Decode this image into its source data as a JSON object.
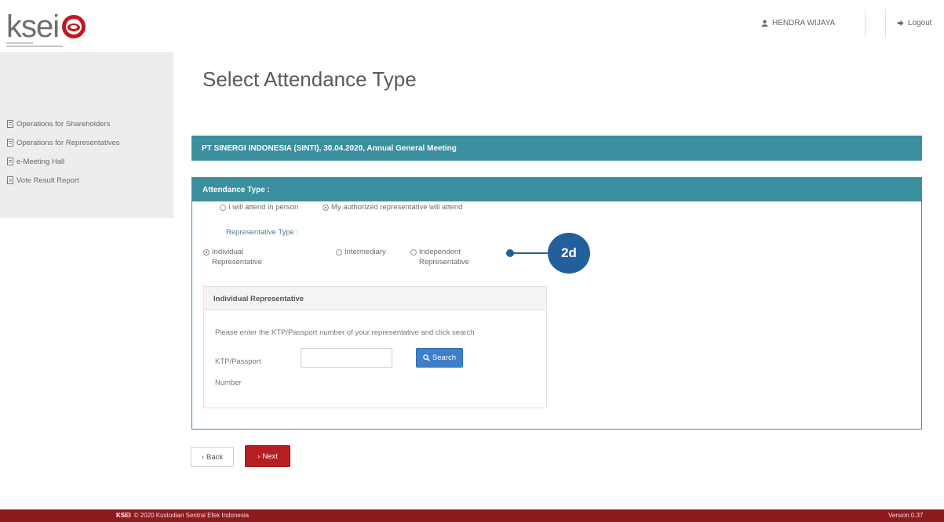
{
  "header": {
    "logo_text": "ksei",
    "user_label": "HENDRA WIJAYA",
    "logout_label": "Logout"
  },
  "sidebar": {
    "items": [
      {
        "label": "Operations for Shareholders",
        "icon": "document-icon"
      },
      {
        "label": "Operations for Representatives",
        "icon": "document-icon"
      },
      {
        "label": "e-Meeting Hall",
        "icon": "document-icon"
      },
      {
        "label": "Vote Result Report",
        "icon": "document-icon"
      }
    ]
  },
  "main": {
    "title": "Select Attendance Type",
    "meeting_info": "PT SINERGI INDONESIA (SINTI), 30.04.2020, Annual General Meeting",
    "attendance_panel": {
      "heading": "Attendance Type :",
      "options": [
        {
          "label": "I will attend in person",
          "selected": false
        },
        {
          "label": "My authorized representative will attend",
          "selected": true
        }
      ],
      "representative_type_label": "Representative Type :",
      "representative_types": [
        {
          "line1": "Individual",
          "line2": "Representative",
          "selected": true
        },
        {
          "line1": "Intermediary",
          "line2": "",
          "selected": false
        },
        {
          "line1": "Independent",
          "line2": "Representative",
          "selected": false
        }
      ],
      "individual_box": {
        "heading": "Individual Representative",
        "description": "Please enter the KTP/Passport number of your representative and click search",
        "ktp_label": "KTP/Passport Number",
        "ktp_value": "",
        "search_label": "Search"
      }
    },
    "callout": "2d",
    "back_label": "Back",
    "next_label": "Next"
  },
  "footer": {
    "brand": "KSEI",
    "copyright": "© 2020 Kustodian Sentral Efek Indonesia",
    "version": "Version 0.37"
  },
  "colors": {
    "teal": "#3b8f9e",
    "brand_red": "#b61f22",
    "footer_red": "#8c1a1e",
    "callout_blue": "#235f9d",
    "search_blue": "#3d7fc9"
  }
}
